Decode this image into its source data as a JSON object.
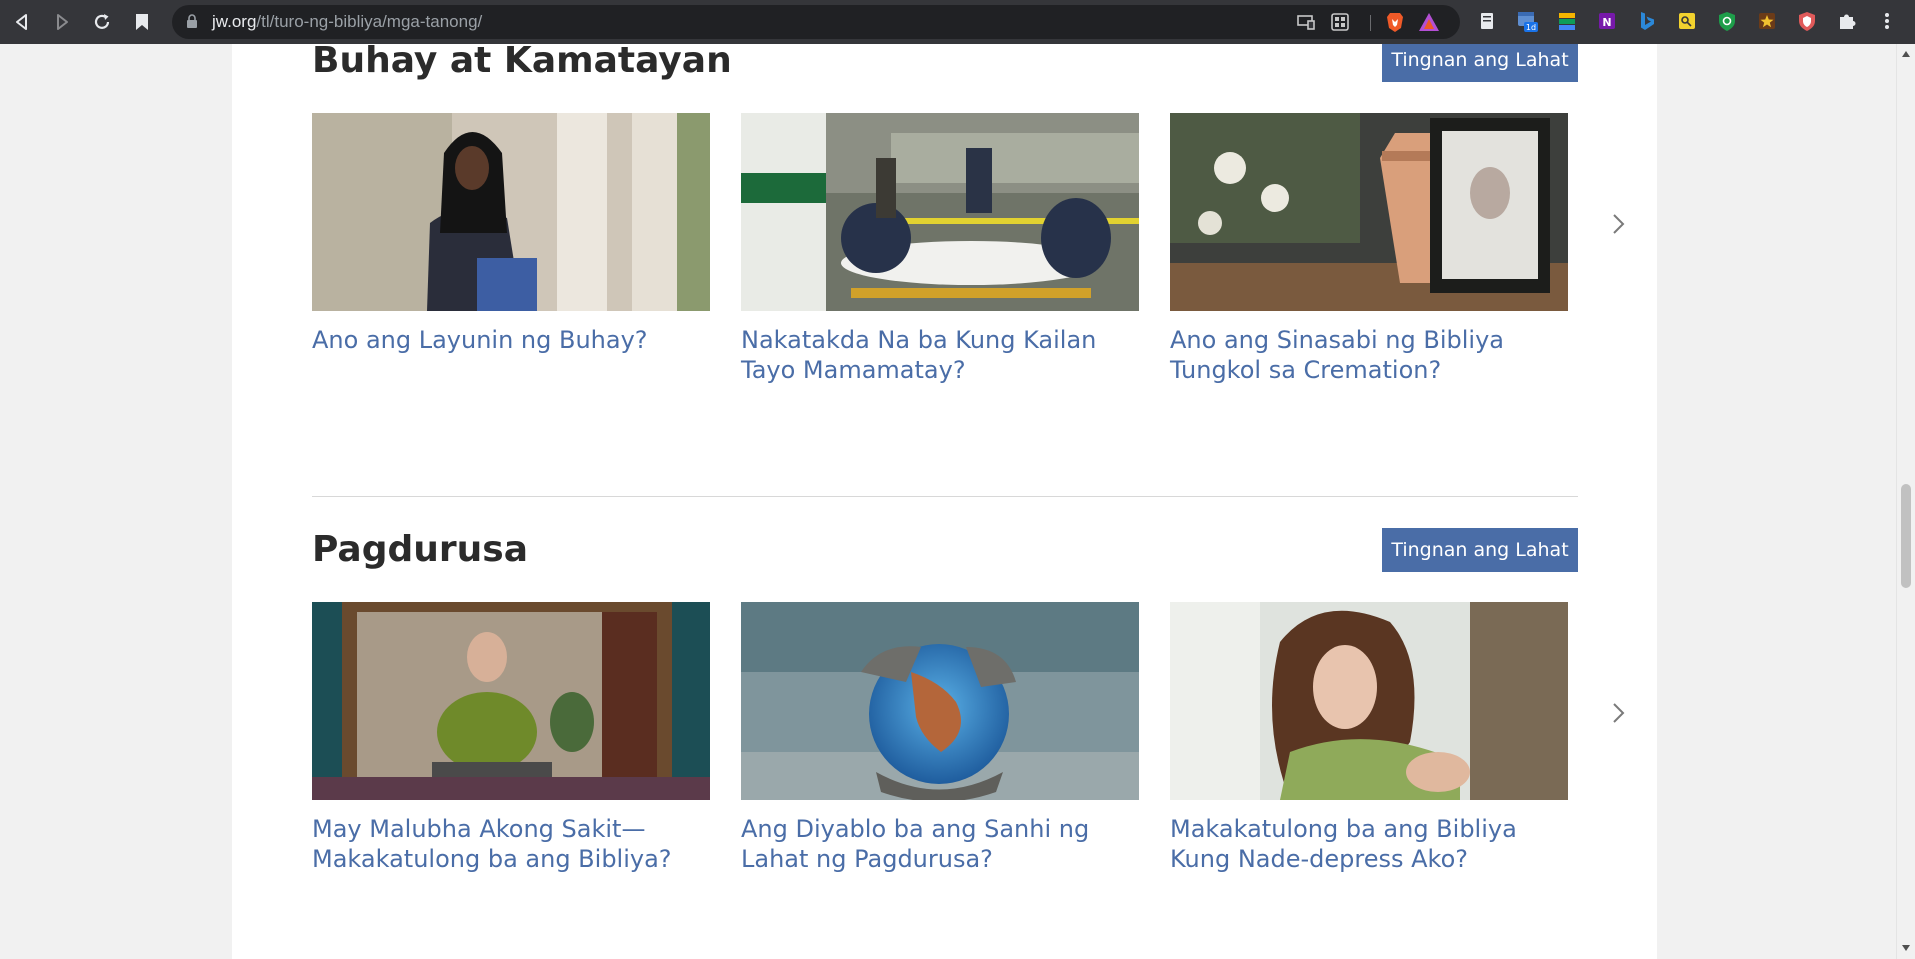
{
  "browser": {
    "url_host": "jw.org",
    "url_path": "/tl/turo-ng-bibliya/mga-tanong/",
    "calendar_badge": "1d"
  },
  "sections": [
    {
      "title": "Buhay at Kamatayan",
      "see_all": "Tingnan ang Lahat",
      "articles": [
        {
          "title": "Ano ang Layunin ng Buhay?"
        },
        {
          "title": "Nakatakda Na ba Kung Kailan Tayo Mamamatay?"
        },
        {
          "title": "Ano ang Sinasabi ng Bibliya Tungkol sa Cremation?"
        }
      ]
    },
    {
      "title": "Pagdurusa",
      "see_all": "Tingnan ang Lahat",
      "articles": [
        {
          "title": "May Malubha Akong Sakit—Makakatulong ba ang Bibliya?"
        },
        {
          "title": "Ang Diyablo ba ang Sanhi ng Lahat ng Pagdurusa?"
        },
        {
          "title": "Makakatulong ba ang Bibliya Kung Nade-depress Ako?"
        }
      ]
    }
  ],
  "colors": {
    "link": "#4a6da7",
    "button": "#4a6da7",
    "heading": "#2b2b2b"
  }
}
